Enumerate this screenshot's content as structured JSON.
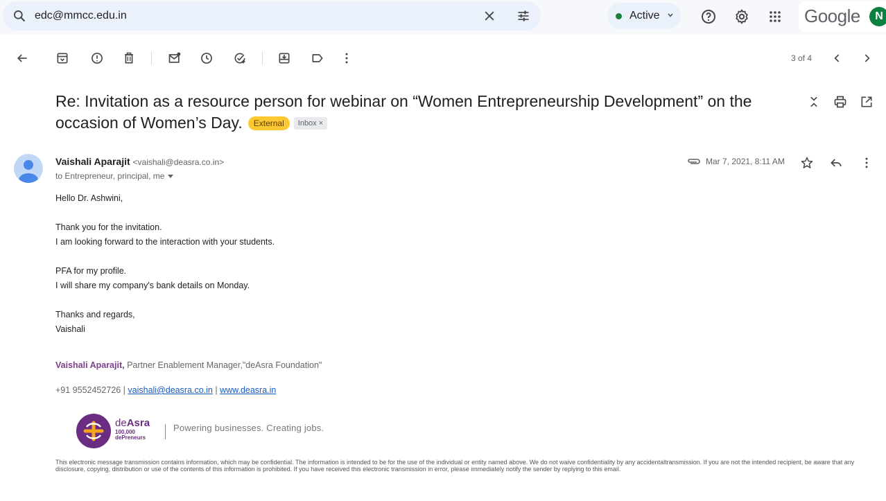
{
  "search": {
    "query": "edc@mmcc.edu.in"
  },
  "status": {
    "label": "Active",
    "color": "#188038"
  },
  "header": {
    "brand": "Google",
    "account_initial": "N"
  },
  "toolbar": {
    "pager": "3 of 4"
  },
  "email": {
    "subject": "Re: Invitation as a resource person for webinar on “Women Entrepreneurship Development” on the occasion of Women’s Day.",
    "labels": {
      "external": "External",
      "inbox": "Inbox",
      "inbox_remove": "×"
    },
    "sender_name": "Vaishali Aparajit",
    "sender_email": "<vaishali@deasra.co.in>",
    "recipients": "to Entrepreneur, principal, me",
    "date": "Mar 7, 2021, 8:11 AM",
    "body": {
      "greeting": "Hello Dr. Ashwini,",
      "p1_l1": "Thank you for the invitation.",
      "p1_l2": "I am looking forward to the interaction with your students.",
      "p2_l1": "PFA for my profile.",
      "p2_l2": "I will share my company's bank details on Monday.",
      "closing": "Thanks and regards,",
      "sign": "Vaishali"
    },
    "signature": {
      "name": "Vaishali Aparajit,",
      "title": " Partner Enablement Manager,\"deAsra Foundation\"",
      "phone": "+91 9552452726 | ",
      "email": "vaishali@deasra.co.in",
      "sep": " | ",
      "website": "www.deasra.in",
      "brand_de": "de",
      "brand_asra": "Asra",
      "brand_sub1": "100,000",
      "brand_sub2": "dePreneurs",
      "tagline": "Powering businesses. Creating jobs."
    },
    "disclaimer": "This electronic message transmission contains information, which may be confidential. The information is intended to be for the use of the individual or entity named above. We do not waive confidentiality by any accidentaltransmission. If you are not the intended recipient, be aware that any disclosure, copying, distribution or use of the contents of this information is prohibited. If you have received this electronic transmission in error, please immediately notify the sender by replying to this email."
  },
  "colors": {
    "external_badge": "#fcc934",
    "brand_purple": "#6b2d82",
    "link": "#1a5bbf"
  }
}
